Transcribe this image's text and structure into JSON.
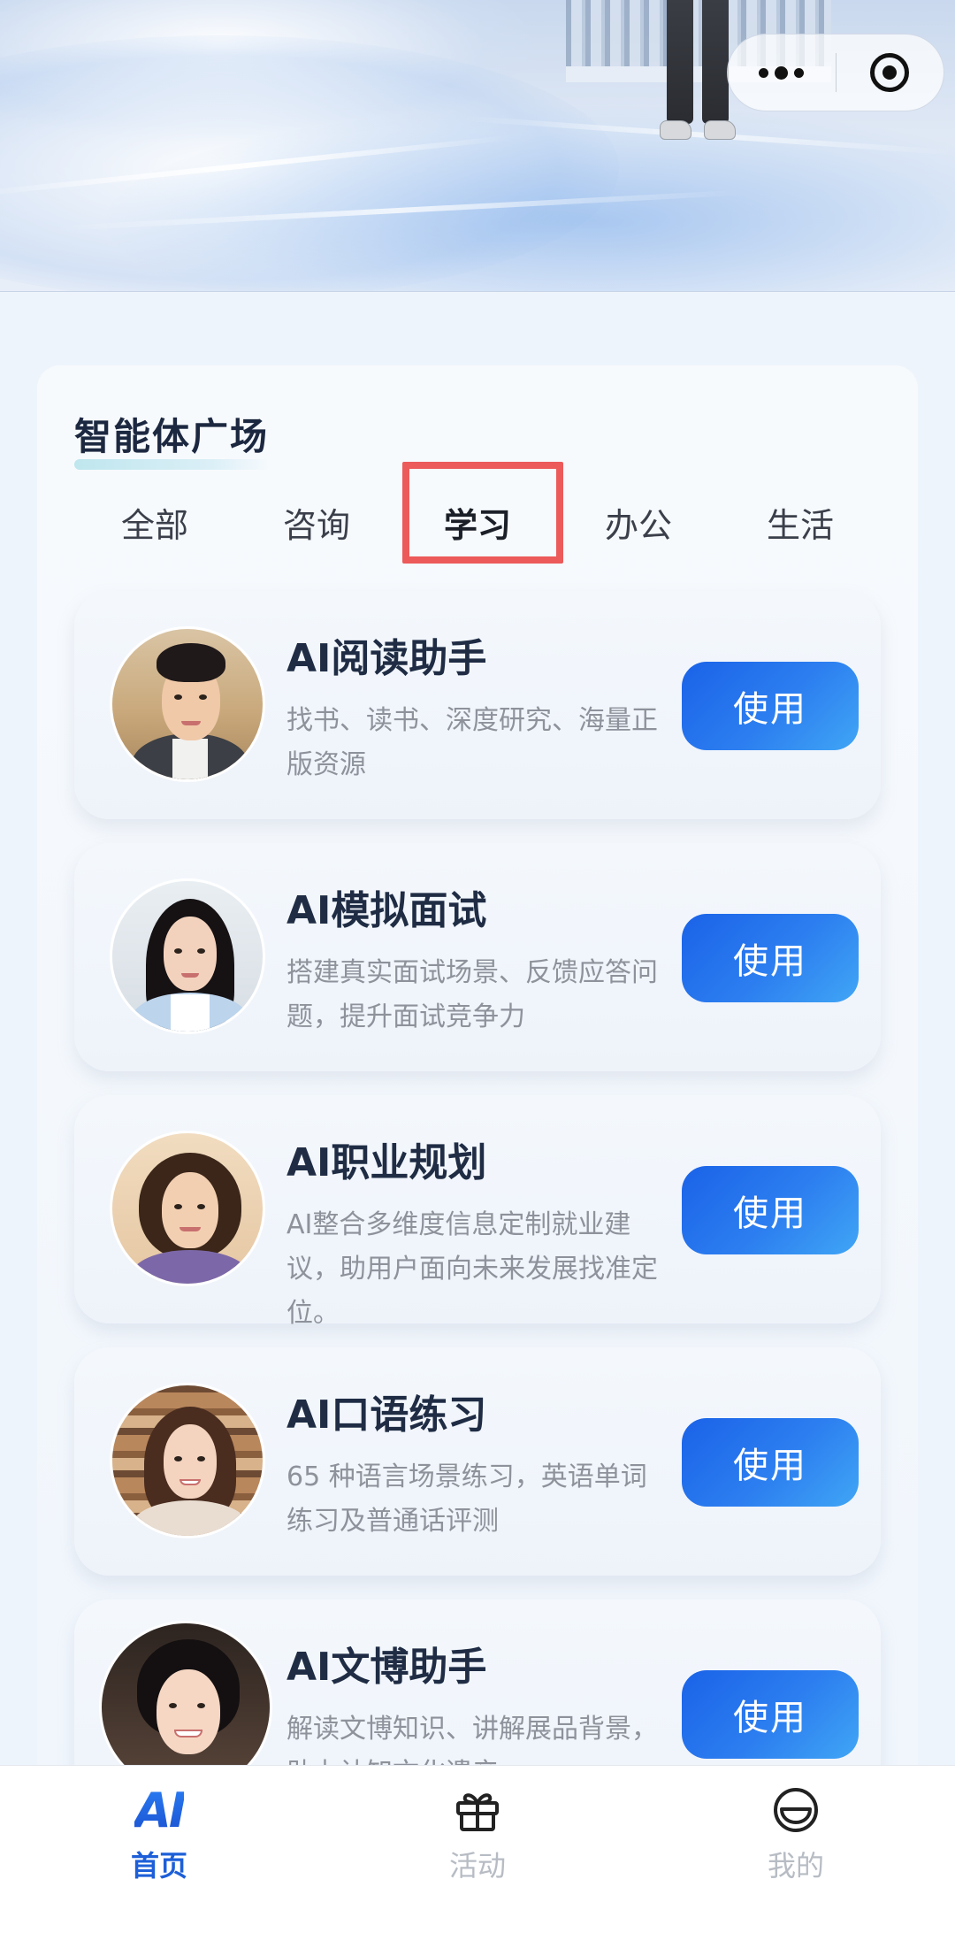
{
  "capsule": {
    "more_icon": "more-dots-icon",
    "close_icon": "target-close-icon"
  },
  "section": {
    "title": "智能体广场"
  },
  "tabs": [
    {
      "label": "全部",
      "active": false
    },
    {
      "label": "咨询",
      "active": false
    },
    {
      "label": "学习",
      "active": true
    },
    {
      "label": "办公",
      "active": false
    },
    {
      "label": "生活",
      "active": false
    }
  ],
  "agents": [
    {
      "name": "AI阅读助手",
      "desc": "找书、读书、深度研究、海量正版资源",
      "button": "使用"
    },
    {
      "name": "AI模拟面试",
      "desc": "搭建真实面试场景、反馈应答问题，提升面试竞争力",
      "button": "使用"
    },
    {
      "name": "AI职业规划",
      "desc": "AI整合多维度信息定制就业建议，助用户面向未来发展找准定位。",
      "button": "使用"
    },
    {
      "name": "AI口语练习",
      "desc": "65 种语言场景练习，英语单词练习及普通话评测",
      "button": "使用"
    },
    {
      "name": "AI文博助手",
      "desc": "解读文博知识、讲解展品背景，助力认知文化遗产",
      "button": "使用"
    }
  ],
  "nav": [
    {
      "label": "首页",
      "icon": "ai-logo-icon",
      "icon_text": "AI",
      "active": true
    },
    {
      "label": "活动",
      "icon": "gift-icon",
      "active": false
    },
    {
      "label": "我的",
      "icon": "profile-face-icon",
      "active": false
    }
  ],
  "colors": {
    "accent": "#1a62e8",
    "highlight": "#ec5a5a",
    "nav_active": "#1d5fd8"
  }
}
